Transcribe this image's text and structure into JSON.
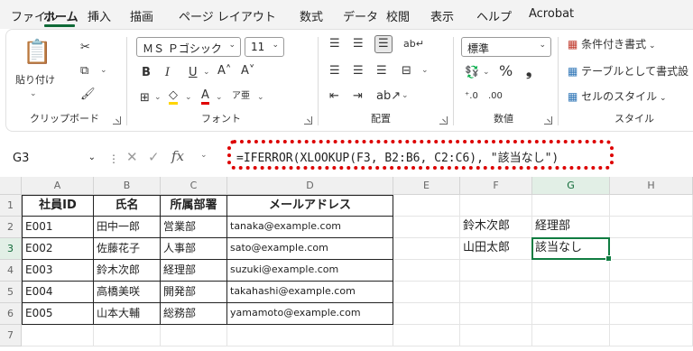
{
  "tabs": [
    "ファイル",
    "ホーム",
    "挿入",
    "描画",
    "ページ レイアウト",
    "数式",
    "データ",
    "校閲",
    "表示",
    "ヘルプ",
    "Acrobat"
  ],
  "ribbon": {
    "clipboard": {
      "paste_label": "貼り付け",
      "group_label": "クリップボード"
    },
    "font": {
      "font_name": "ＭＳ Ｐゴシック",
      "font_size": "11",
      "group_label": "フォント",
      "grow": "A˄",
      "shrink": "A˅",
      "bold": "B",
      "italic": "I",
      "underline": "U",
      "font_color": "A"
    },
    "alignment": {
      "group_label": "配置"
    },
    "number": {
      "format": "標準",
      "percent": "%",
      "comma": "❟",
      "group_label": "数値"
    },
    "styles": {
      "conditional": "条件付き書式",
      "table": "テーブルとして書式設",
      "cell_styles": "セルのスタイル",
      "group_label": "スタイル"
    }
  },
  "formula_bar": {
    "cell_ref": "G3",
    "fx": "fx",
    "formula": "=IFERROR(XLOOKUP(F3, B2:B6, C2:C6), \"該当なし\")"
  },
  "columns": [
    "A",
    "B",
    "C",
    "D",
    "E",
    "F",
    "G",
    "H"
  ],
  "rows": [
    "1",
    "2",
    "3",
    "4",
    "5",
    "6",
    "7"
  ],
  "table": {
    "headers": [
      "社員ID",
      "氏名",
      "所属部署",
      "メールアドレス"
    ],
    "rows": [
      [
        "E001",
        "田中一郎",
        "営業部",
        "tanaka@example.com"
      ],
      [
        "E002",
        "佐藤花子",
        "人事部",
        "sato@example.com"
      ],
      [
        "E003",
        "鈴木次郎",
        "経理部",
        "suzuki@example.com"
      ],
      [
        "E004",
        "高橋美咲",
        "開発部",
        "takahashi@example.com"
      ],
      [
        "E005",
        "山本大輔",
        "総務部",
        "yamamoto@example.com"
      ]
    ]
  },
  "lookup": [
    [
      "鈴木次郎",
      "経理部"
    ],
    [
      "山田太郎",
      "該当なし"
    ]
  ],
  "selected_cell": "G3",
  "colors": {
    "accent": "#107c41",
    "highlight": "#dd0000"
  }
}
